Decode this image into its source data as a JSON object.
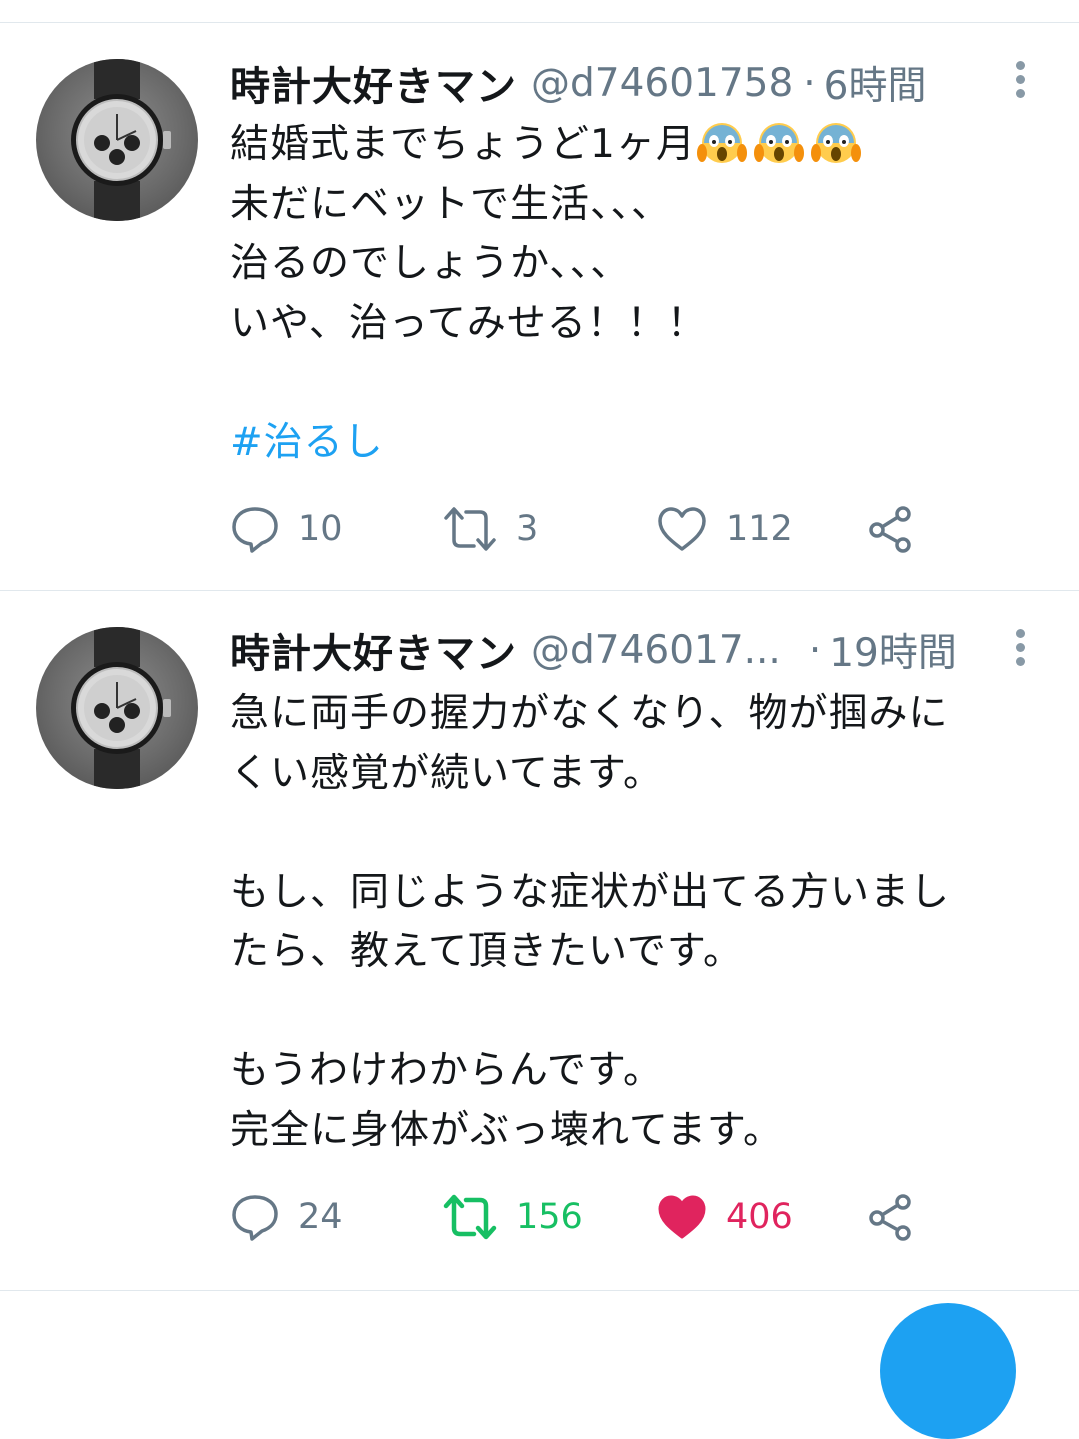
{
  "tweets": [
    {
      "author_name": "時計大好きマン",
      "handle": "@d74601758",
      "separator": "·",
      "time": "6時間",
      "body_lines": [
        "結婚式までちょうど1ヶ月",
        "未だにベットで生活、、、",
        "治るのでしょうか、、、",
        "いや、治ってみせる！！！"
      ],
      "emoji": "screaming-face-emoji",
      "hashtag": "#治るし",
      "replies": "10",
      "retweets": "3",
      "likes": "112",
      "retweeted": false,
      "liked": false
    },
    {
      "author_name": "時計大好きマン",
      "handle": "@d746017...",
      "separator": "·",
      "time": "19時間",
      "paragraphs": [
        [
          "急に両手の握力がなくなり、物が掴みに",
          "くい感覚が続いてます。"
        ],
        [
          "もし、同じような症状が出てる方いまし",
          "たら、教えて頂きたいです。"
        ],
        [
          "もうわけわからんです。",
          "完全に身体がぶっ壊れてます。"
        ]
      ],
      "replies": "24",
      "retweets": "156",
      "likes": "406",
      "retweeted": true,
      "liked": true
    }
  ],
  "icons": {
    "reply": "speech-bubble-icon",
    "retweet": "retweet-arrows-icon",
    "like": "heart-icon",
    "share": "share-nodes-icon",
    "more": "vertical-ellipsis-icon"
  },
  "colors": {
    "link": "#1da1f2",
    "secondary_text": "#657786",
    "retweet_active": "#17bf63",
    "like_active": "#e0245e",
    "divider": "#e1e8ed",
    "fab": "#1da1f2"
  }
}
